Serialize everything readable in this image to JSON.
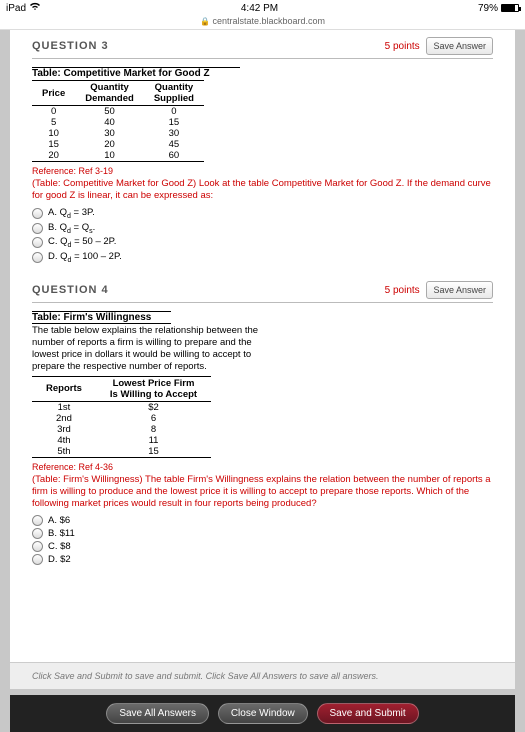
{
  "status": {
    "device": "iPad",
    "time": "4:42 PM",
    "battery": "79%",
    "url": "centralstate.blackboard.com"
  },
  "q3": {
    "title": "QUESTION 3",
    "points": "5 points",
    "save": "Save Answer",
    "table_title": "Table: Competitive Market for Good Z",
    "headers": {
      "price": "Price",
      "qd": "Quantity Demanded",
      "qs": "Quantity Supplied"
    },
    "rows": [
      {
        "p": "0",
        "d": "50",
        "s": "0"
      },
      {
        "p": "5",
        "d": "40",
        "s": "15"
      },
      {
        "p": "10",
        "d": "30",
        "s": "30"
      },
      {
        "p": "15",
        "d": "20",
        "s": "45"
      },
      {
        "p": "20",
        "d": "10",
        "s": "60"
      }
    ],
    "reference": "Reference: Ref 3-19",
    "prompt": "(Table: Competitive Market for Good Z) Look at the table Competitive Market for Good Z. If the demand curve for good Z is linear, it can be expressed as:",
    "options": {
      "a_pre": "A. Q",
      "a_sub": "d",
      "a_post": " = 3P.",
      "b_pre": "B. Q",
      "b_sub1": "d",
      "b_mid": " = Q",
      "b_sub2": "s",
      "b_post": ".",
      "c_pre": "C. Q",
      "c_sub": "d",
      "c_post": " = 50 – 2P.",
      "d_pre": "D. Q",
      "d_sub": "d",
      "d_post": " = 100 – 2P."
    }
  },
  "q4": {
    "title": "QUESTION 4",
    "points": "5 points",
    "save": "Save Answer",
    "table_title": "Table: Firm's Willingness",
    "description": "The table below explains the relationship between the number of reports a firm is willing to prepare and the lowest price in dollars it would be willing to accept to prepare the respective number of reports.",
    "headers": {
      "reports": "Reports",
      "price": "Lowest Price Firm Is Willing to Accept"
    },
    "rows": [
      {
        "r": "1st",
        "p": "$2"
      },
      {
        "r": "2nd",
        "p": "6"
      },
      {
        "r": "3rd",
        "p": "8"
      },
      {
        "r": "4th",
        "p": "11"
      },
      {
        "r": "5th",
        "p": "15"
      }
    ],
    "reference": "Reference: Ref 4-36",
    "prompt": "(Table: Firm's Willingness) The table Firm's Willingness explains the relation between the number of reports a firm is willing to produce and the lowest price it is willing to accept to prepare those reports. Which of the following market prices would result in four reports being produced?",
    "options": {
      "a": "A. $6",
      "b": "B. $11",
      "c": "C. $8",
      "d": "D. $2"
    }
  },
  "footer": {
    "instruction": "Click Save and Submit to save and submit. Click Save All Answers to save all answers.",
    "save_all": "Save All Answers",
    "close": "Close Window",
    "submit": "Save and Submit"
  }
}
